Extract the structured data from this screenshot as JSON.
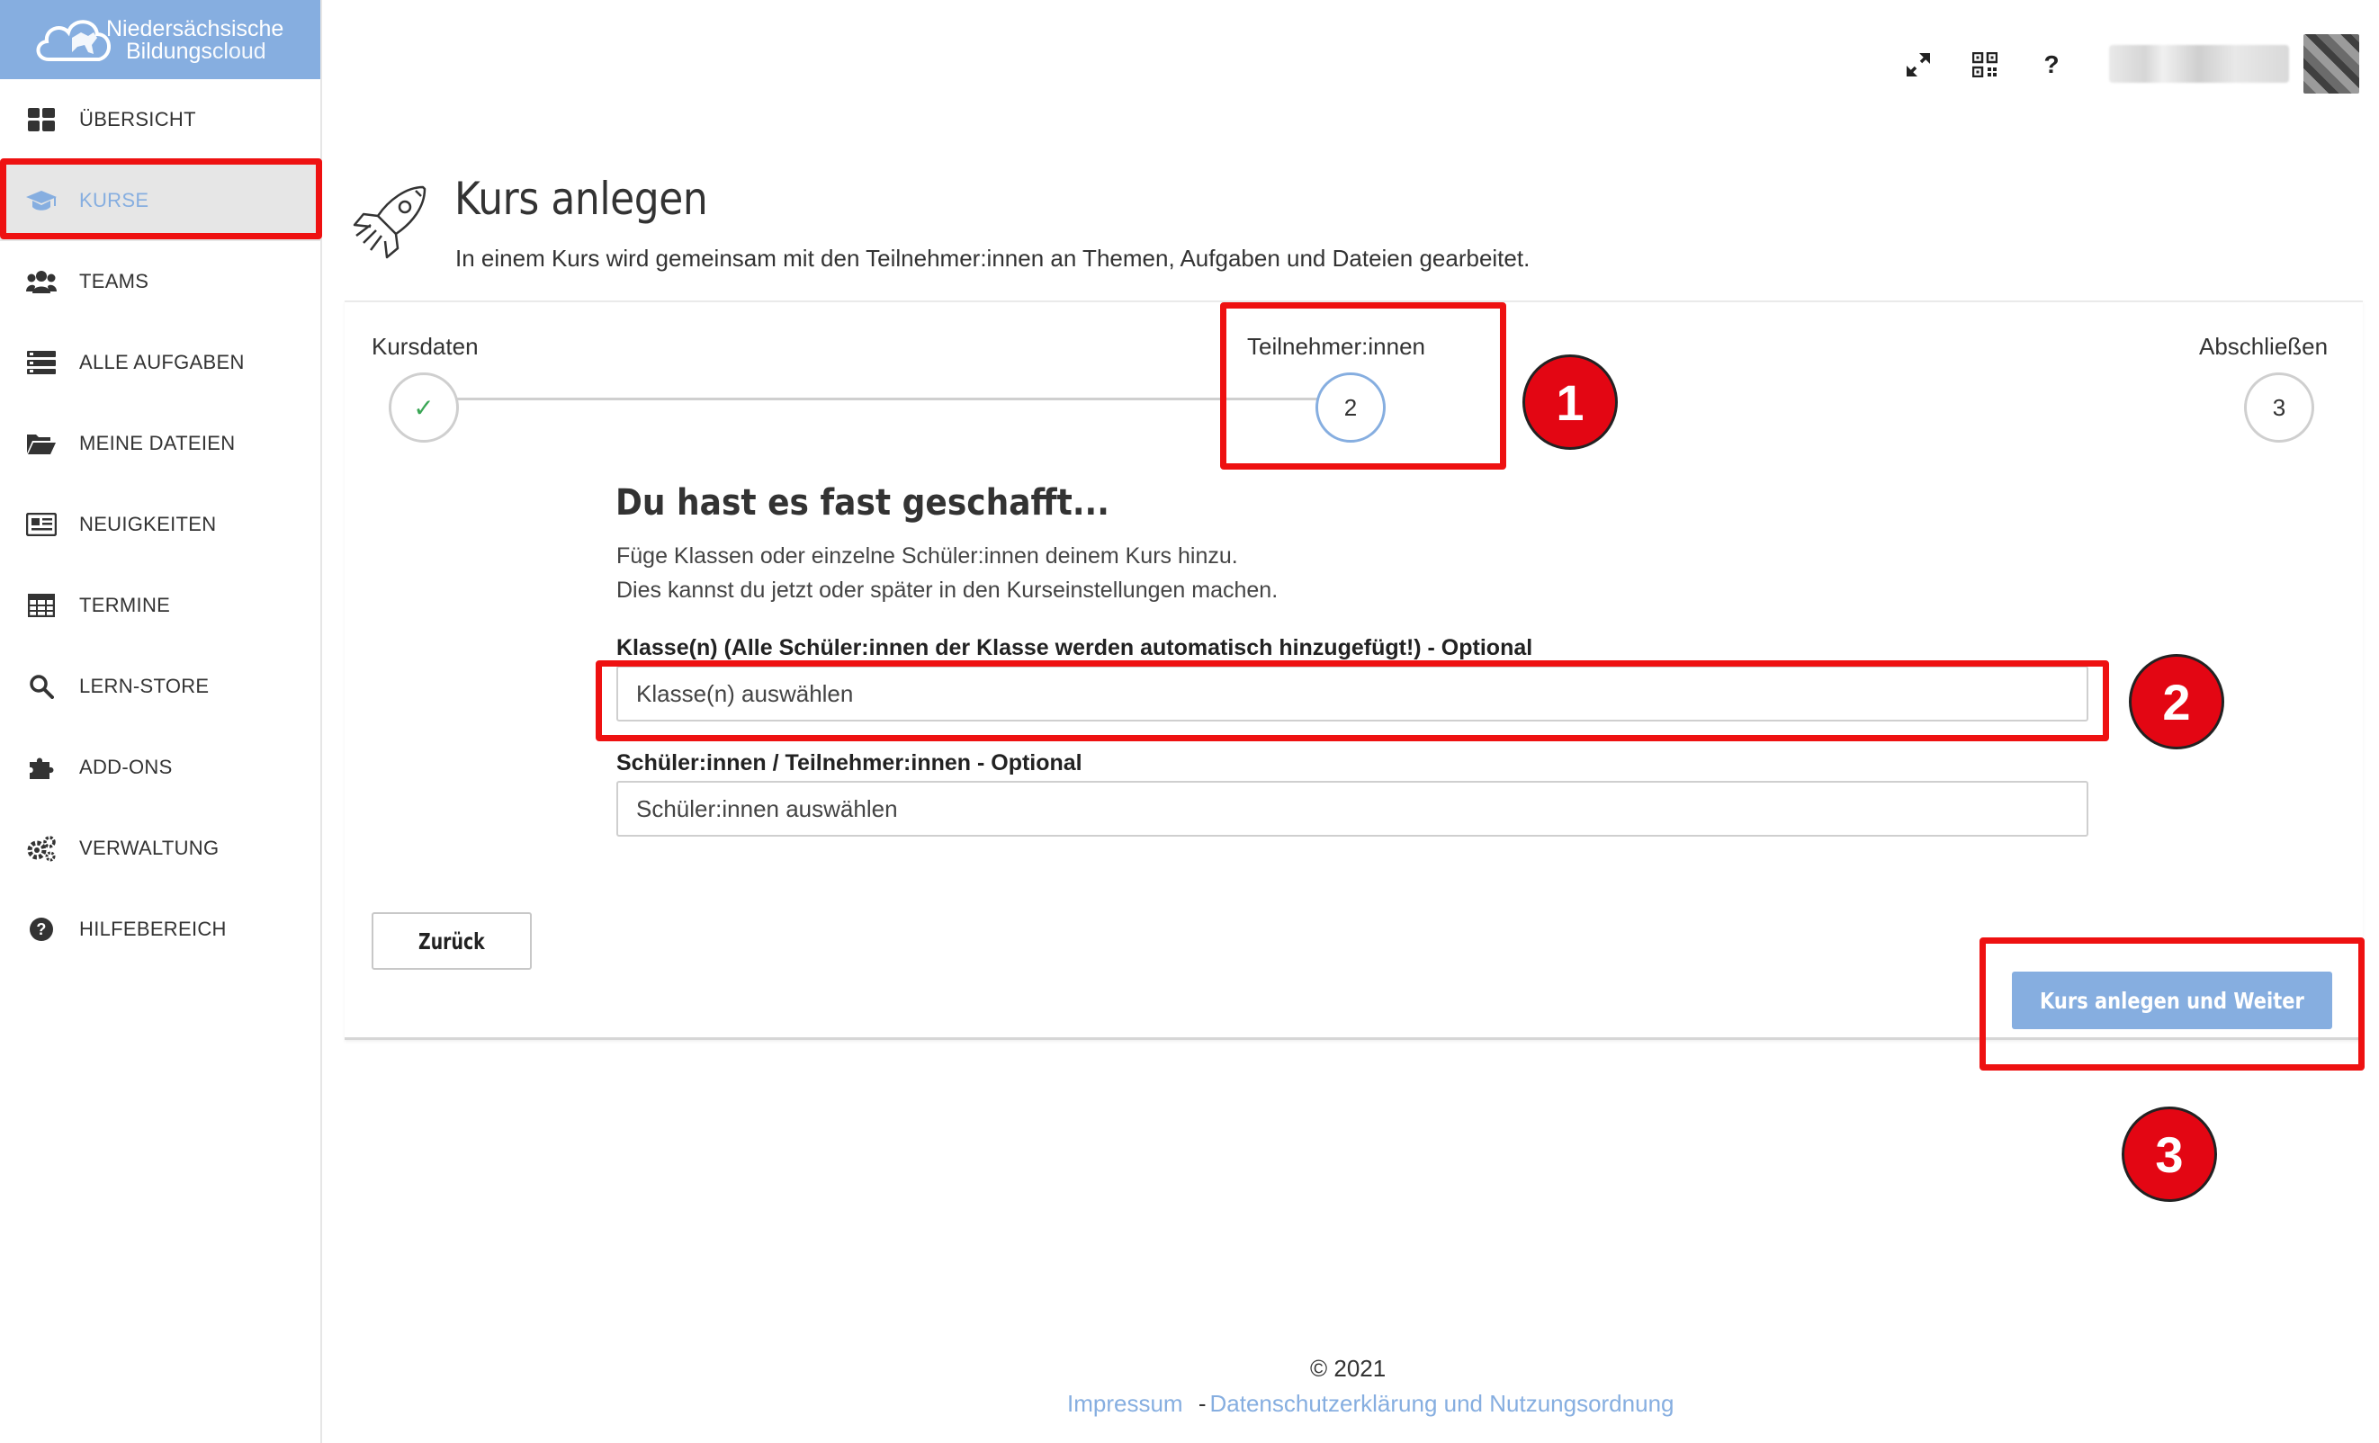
{
  "brand": {
    "line1": "Niedersächsische",
    "line2_prefix": "Bildungs",
    "line2_suffix": "cloud"
  },
  "sidebar": {
    "items": [
      {
        "label": "ÜBERSICHT",
        "icon": "dashboard-icon"
      },
      {
        "label": "KURSE",
        "icon": "graduation-cap-icon",
        "active": true
      },
      {
        "label": "TEAMS",
        "icon": "users-icon"
      },
      {
        "label": "ALLE AUFGABEN",
        "icon": "tasks-icon"
      },
      {
        "label": "MEINE DATEIEN",
        "icon": "folder-open-icon"
      },
      {
        "label": "NEUIGKEITEN",
        "icon": "newspaper-icon"
      },
      {
        "label": "TERMINE",
        "icon": "calendar-table-icon"
      },
      {
        "label": "LERN-STORE",
        "icon": "search-icon"
      },
      {
        "label": "ADD-ONS",
        "icon": "puzzle-icon"
      },
      {
        "label": "VERWALTUNG",
        "icon": "cogs-icon"
      },
      {
        "label": "HILFEBEREICH",
        "icon": "help-circle-icon"
      }
    ]
  },
  "topbar": {
    "help_label": "?"
  },
  "page": {
    "title": "Kurs anlegen",
    "subtitle": "In einem Kurs wird gemeinsam mit den Teilnehmer:innen an Themen, Aufgaben und Dateien gearbeitet."
  },
  "wizard": {
    "steps": [
      {
        "label": "Kursdaten",
        "marker": "✓",
        "state": "done"
      },
      {
        "label": "Teilnehmer:innen",
        "marker": "2",
        "state": "current"
      },
      {
        "label": "Abschließen",
        "marker": "3",
        "state": "pending"
      }
    ],
    "form_title": "Du hast es fast geschafft...",
    "desc_line1": "Füge Klassen oder einzelne Schüler:innen deinem Kurs hinzu.",
    "desc_line2": "Dies kannst du jetzt oder später in den Kurseinstellungen machen.",
    "classes_label": "Klasse(n) (Alle Schüler:innen der Klasse werden automatisch hinzugefügt!) - Optional",
    "classes_placeholder": "Klasse(n) auswählen",
    "students_label": "Schüler:innen / Teilnehmer:innen - Optional",
    "students_placeholder": "Schüler:innen auswählen",
    "back_button": "Zurück",
    "submit_button": "Kurs anlegen und Weiter"
  },
  "annotations": {
    "badge1": "1",
    "badge2": "2",
    "badge3": "3",
    "color": "#e30613"
  },
  "footer": {
    "copyright": "© 2021",
    "impressum": "Impressum",
    "separator": "-",
    "privacy": "Datenschutzerklärung und Nutzungsordnung"
  },
  "colors": {
    "accent": "#86aee0",
    "annotation_red": "#ee1111",
    "success": "#3aa655"
  }
}
